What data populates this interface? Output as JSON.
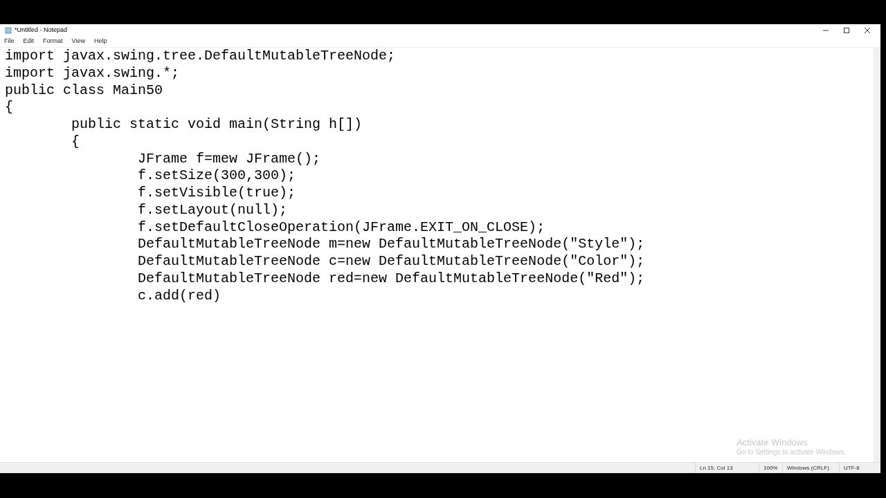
{
  "window": {
    "title": "*Untitled - Notepad"
  },
  "menu": [
    "File",
    "Edit",
    "Format",
    "View",
    "Help"
  ],
  "editor": {
    "lines": [
      "import javax.swing.tree.DefaultMutableTreeNode;",
      "import javax.swing.*;",
      "public class Main50",
      "{",
      "\tpublic static void main(String h[])",
      "\t{",
      "\t\tJFrame f=mew JFrame();",
      "\t\tf.setSize(300,300);",
      "\t\tf.setVisible(true);",
      "\t\tf.setLayout(null);",
      "\t\tf.setDefaultCloseOperation(JFrame.EXIT_ON_CLOSE);",
      "\t\tDefaultMutableTreeNode m=new DefaultMutableTreeNode(\"Style\");",
      "\t\tDefaultMutableTreeNode c=new DefaultMutableTreeNode(\"Color\");",
      "\t\tDefaultMutableTreeNode red=new DefaultMutableTreeNode(\"Red\");",
      "\t\tc.add(red)"
    ]
  },
  "activation_notice": {
    "title": "Activate Windows",
    "message": "Go to Settings to activate Windows."
  },
  "status_bar": [
    "Ln 15, Col 13",
    "100%",
    "Windows (CRLF)",
    "UTF-8"
  ]
}
